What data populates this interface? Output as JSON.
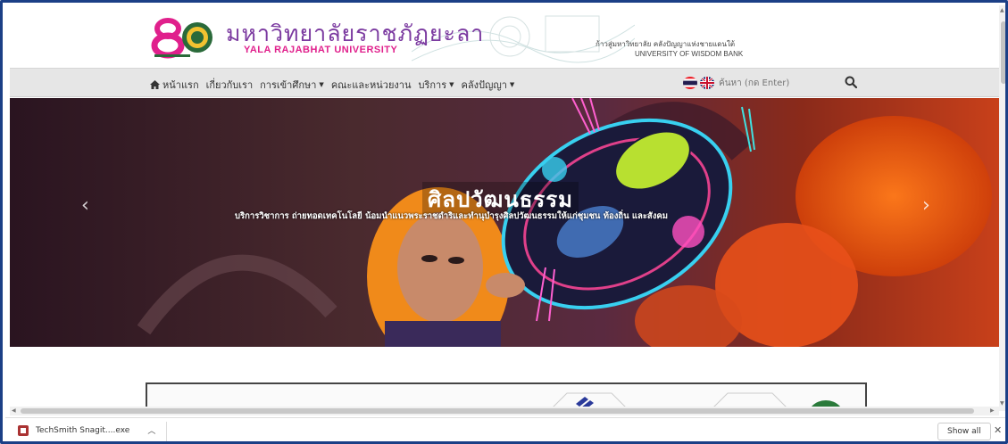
{
  "header": {
    "logo_number": "80",
    "title_th": "มหาวิทยาลัยราชภัฏยะลา",
    "title_en": "YALA RAJABHAT UNIVERSITY",
    "slogan_th": "ก้าวสู่มหาวิทยาลัย คลังปัญญาแห่งชายแดนใต้",
    "slogan_en": "UNIVERSITY OF WISDOM BANK"
  },
  "nav": {
    "items": [
      {
        "label": "หน้าแรก",
        "icon": "home-icon",
        "dropdown": false
      },
      {
        "label": "เกี่ยวกับเรา",
        "dropdown": false
      },
      {
        "label": "การเข้าศึกษา",
        "dropdown": true
      },
      {
        "label": "คณะและหน่วยงาน",
        "dropdown": false
      },
      {
        "label": "บริการ",
        "dropdown": true
      },
      {
        "label": "คลังปัญญา",
        "dropdown": true
      }
    ],
    "search_placeholder": "ค้นหา (กด Enter)",
    "flags": [
      "thai-flag-icon",
      "uk-flag-icon"
    ]
  },
  "hero": {
    "title": "ศิลปวัฒนธรรม",
    "subtitle": "บริการวิชาการ ถ่ายทอดเทคโนโลยี น้อมนำแนวพระราชดำริและทำนุบำรุงศิลปวัฒนธรรมให้แก่ชุมชน ท้องถิ่น และสังคม",
    "prev_arrow": "‹",
    "next_arrow": "›"
  },
  "download_bar": {
    "file_name": "TechSmith Snagit....exe",
    "show_all": "Show all",
    "close": "✕"
  },
  "colors": {
    "frame": "#1b3f86",
    "title_purple": "#7b3aa0",
    "title_pink": "#e0208c",
    "nav_bg": "#e6e6e6"
  }
}
